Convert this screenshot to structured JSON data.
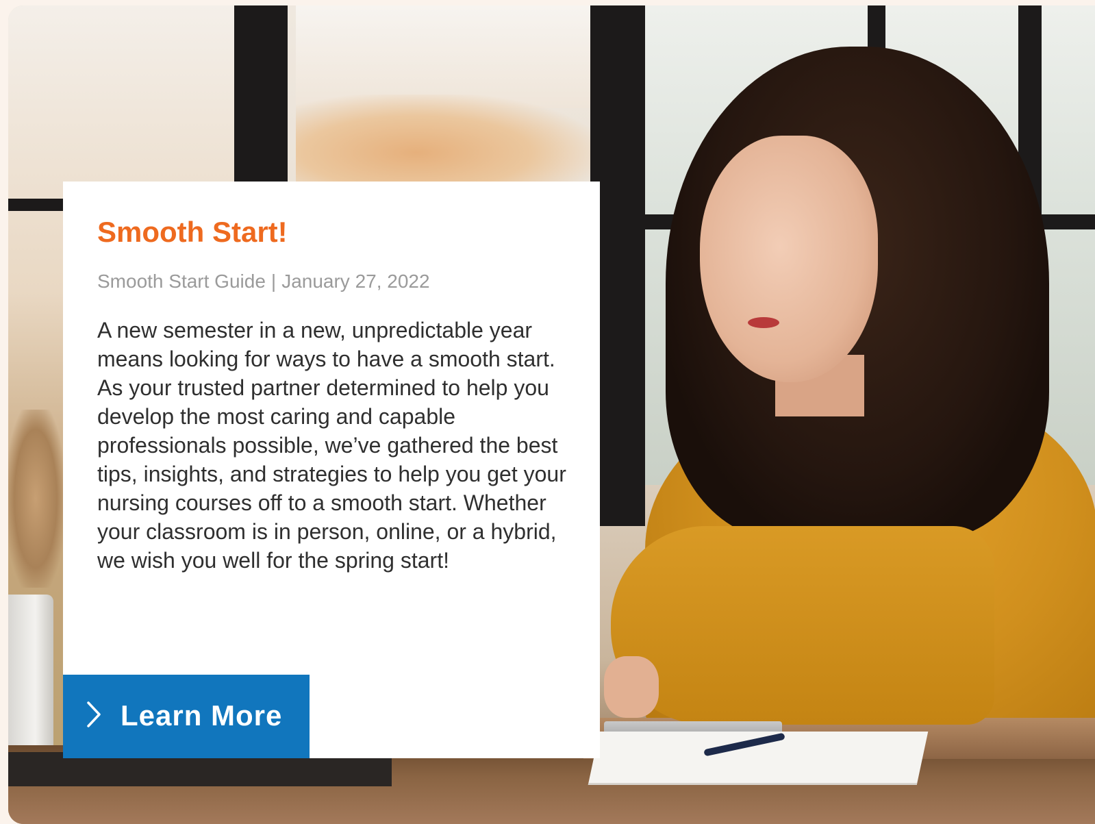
{
  "card": {
    "title": "Smooth Start!",
    "meta": {
      "category": "Smooth Start Guide",
      "separator": "|",
      "date": "January 27, 2022"
    },
    "body": "A new semester in a new, unpredictable year means looking for ways to have a smooth start. As your trusted partner determined to help you develop the most caring and capable professionals possible, we’ve gathered the best tips, insights, and strategies to help you get your nursing courses off to a smooth start. Whether your classroom is in person, online, or a hybrid, we wish you well for the spring start!",
    "cta": {
      "label": "Learn More",
      "icon": "chevron-right-icon"
    }
  },
  "colors": {
    "title": "#ee6a1f",
    "meta": "#9a9a9a",
    "body": "#2f2f2f",
    "button": "#1176bd",
    "button_text": "#ffffff"
  },
  "hero_image": {
    "icon": "photo-icon"
  }
}
